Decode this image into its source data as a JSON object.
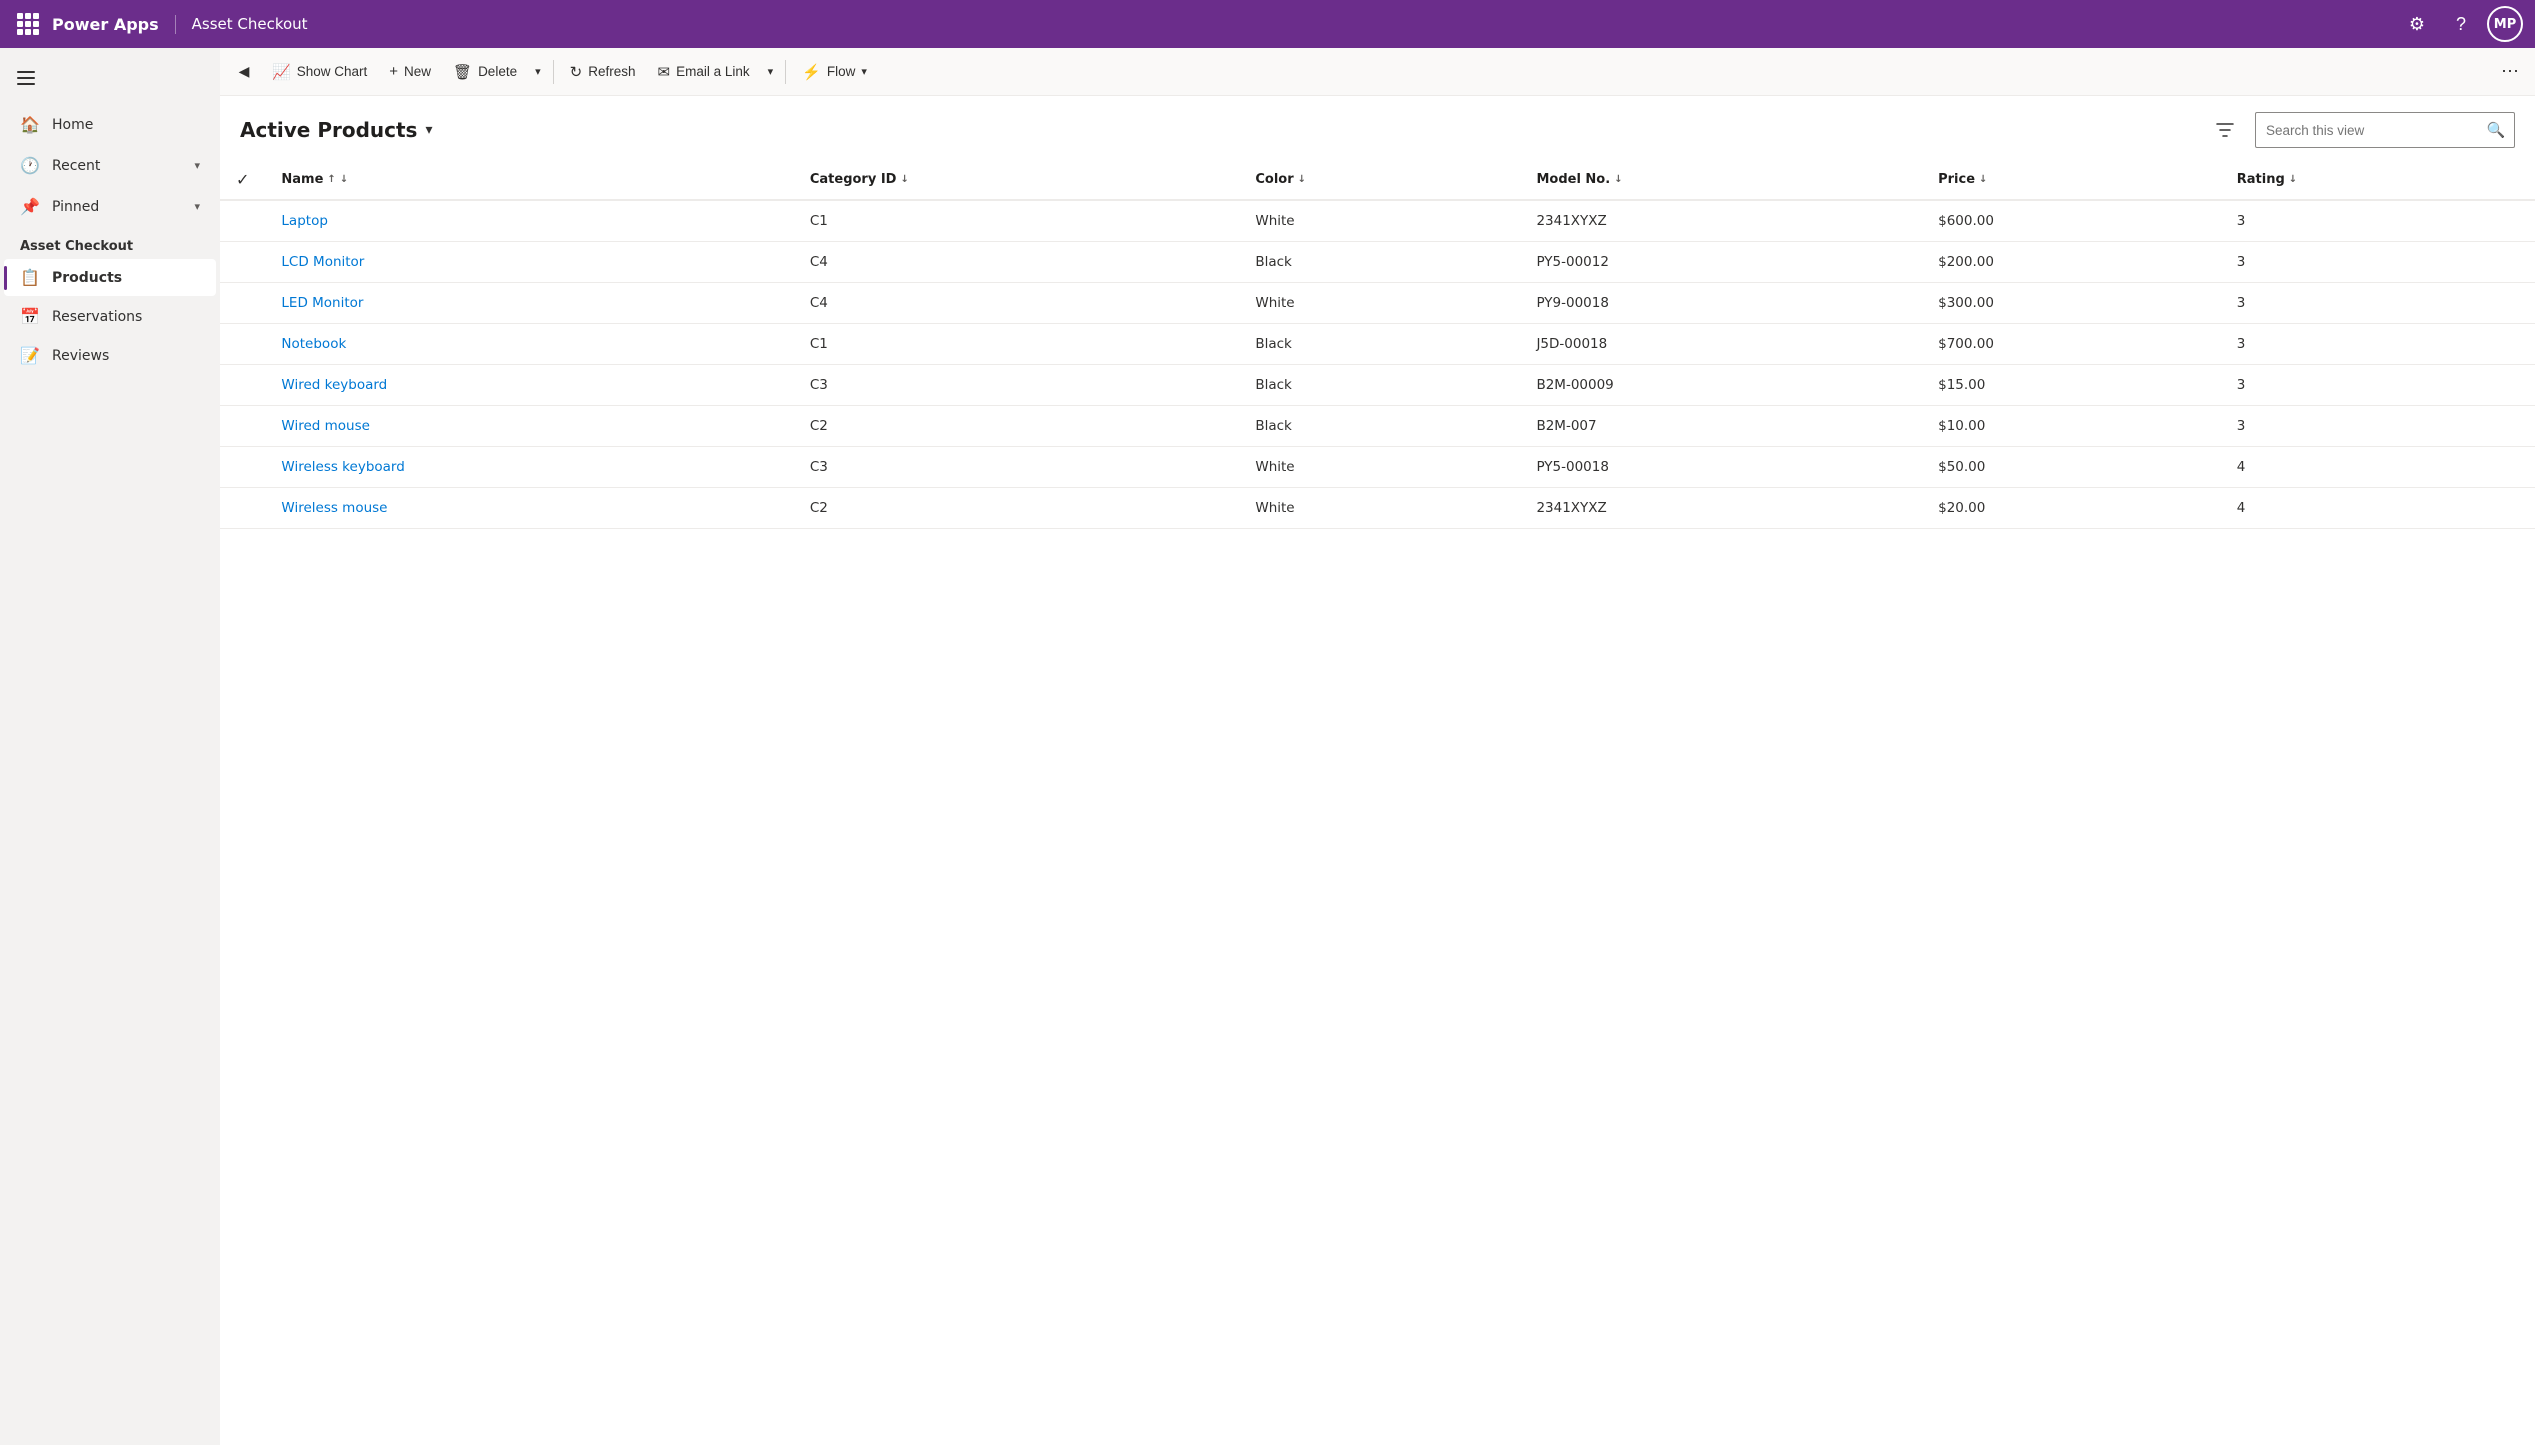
{
  "header": {
    "appName": "Power Apps",
    "appContext": "Asset Checkout",
    "settingsLabel": "Settings",
    "helpLabel": "Help",
    "avatarLabel": "MP",
    "waffleLabel": "App launcher"
  },
  "sidebar": {
    "hamburgerLabel": "Toggle navigation",
    "navItems": [
      {
        "label": "Home",
        "icon": "🏠"
      },
      {
        "label": "Recent",
        "icon": "🕐",
        "hasChevron": true
      },
      {
        "label": "Pinned",
        "icon": "📌",
        "hasChevron": true
      }
    ],
    "sectionLabel": "Asset Checkout",
    "appItems": [
      {
        "label": "Products",
        "icon": "📋",
        "active": true
      },
      {
        "label": "Reservations",
        "icon": "📅",
        "active": false
      },
      {
        "label": "Reviews",
        "icon": "📝",
        "active": false
      }
    ]
  },
  "toolbar": {
    "backLabel": "Back",
    "showChartLabel": "Show Chart",
    "newLabel": "New",
    "deleteLabel": "Delete",
    "refreshLabel": "Refresh",
    "emailLinkLabel": "Email a Link",
    "flowLabel": "Flow",
    "moreLabel": "More"
  },
  "view": {
    "title": "Active Products",
    "searchPlaceholder": "Search this view",
    "filterLabel": "Filter"
  },
  "table": {
    "columns": [
      {
        "label": "Name",
        "sortable": true,
        "sortDir": "asc"
      },
      {
        "label": "Category ID",
        "sortable": true
      },
      {
        "label": "Color",
        "sortable": true
      },
      {
        "label": "Model No.",
        "sortable": true
      },
      {
        "label": "Price",
        "sortable": true
      },
      {
        "label": "Rating",
        "sortable": true
      }
    ],
    "rows": [
      {
        "name": "Laptop",
        "categoryId": "C1",
        "color": "White",
        "modelNo": "2341XYXZ",
        "price": "$600.00",
        "rating": "3"
      },
      {
        "name": "LCD Monitor",
        "categoryId": "C4",
        "color": "Black",
        "modelNo": "PY5-00012",
        "price": "$200.00",
        "rating": "3"
      },
      {
        "name": "LED Monitor",
        "categoryId": "C4",
        "color": "White",
        "modelNo": "PY9-00018",
        "price": "$300.00",
        "rating": "3"
      },
      {
        "name": "Notebook",
        "categoryId": "C1",
        "color": "Black",
        "modelNo": "J5D-00018",
        "price": "$700.00",
        "rating": "3"
      },
      {
        "name": "Wired keyboard",
        "categoryId": "C3",
        "color": "Black",
        "modelNo": "B2M-00009",
        "price": "$15.00",
        "rating": "3"
      },
      {
        "name": "Wired mouse",
        "categoryId": "C2",
        "color": "Black",
        "modelNo": "B2M-007",
        "price": "$10.00",
        "rating": "3"
      },
      {
        "name": "Wireless keyboard",
        "categoryId": "C3",
        "color": "White",
        "modelNo": "PY5-00018",
        "price": "$50.00",
        "rating": "4"
      },
      {
        "name": "Wireless mouse",
        "categoryId": "C2",
        "color": "White",
        "modelNo": "2341XYXZ",
        "price": "$20.00",
        "rating": "4"
      }
    ]
  },
  "colors": {
    "headerBg": "#6b2d8b",
    "linkColor": "#0078d4",
    "activeBorder": "#6b2d8b"
  }
}
